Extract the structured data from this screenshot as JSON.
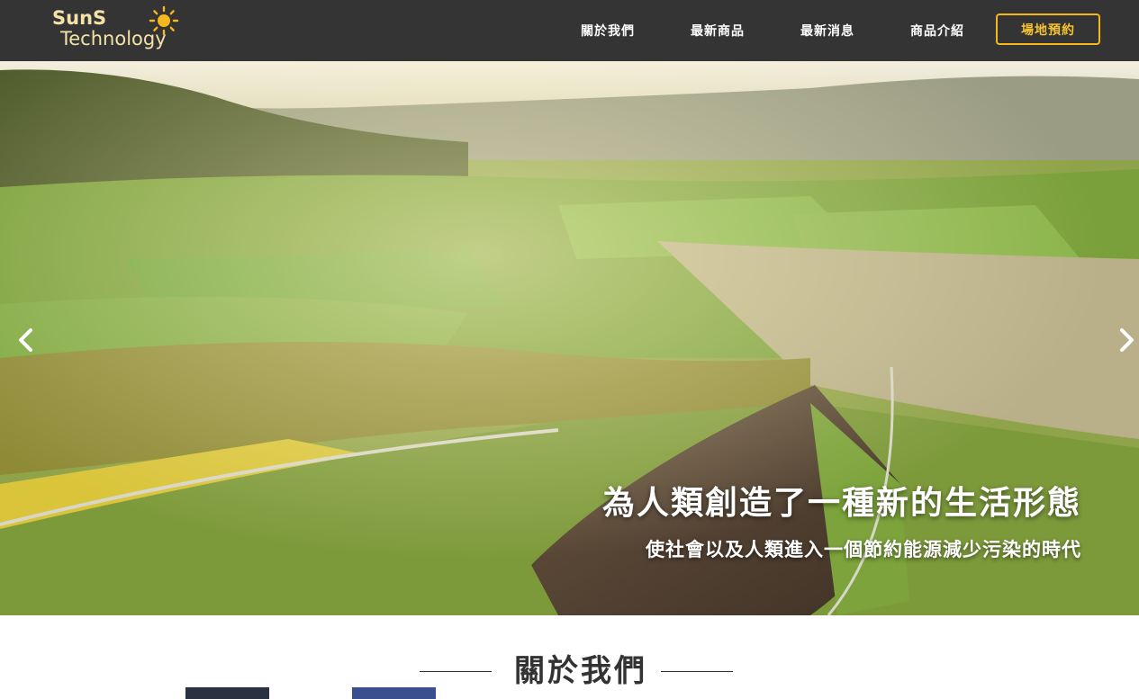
{
  "header": {
    "logo": {
      "line1": "SunS",
      "line2": "Technology",
      "icon": "sun-icon"
    },
    "nav": [
      {
        "label": "關於我們"
      },
      {
        "label": "最新商品"
      },
      {
        "label": "最新消息"
      },
      {
        "label": "商品介紹"
      }
    ],
    "cta_label": "場地預約"
  },
  "hero": {
    "title": "為人類創造了一種新的生活形態",
    "subtitle": "使社會以及人類進入一個節約能源減少污染的時代",
    "prev_icon": "chevron-left-icon",
    "next_icon": "chevron-right-icon"
  },
  "about": {
    "heading": "關於我們"
  },
  "colors": {
    "header_bg": "#343434",
    "accent": "#f5b71b",
    "logo_text": "#f3e3a8",
    "heading_text": "#333333"
  }
}
